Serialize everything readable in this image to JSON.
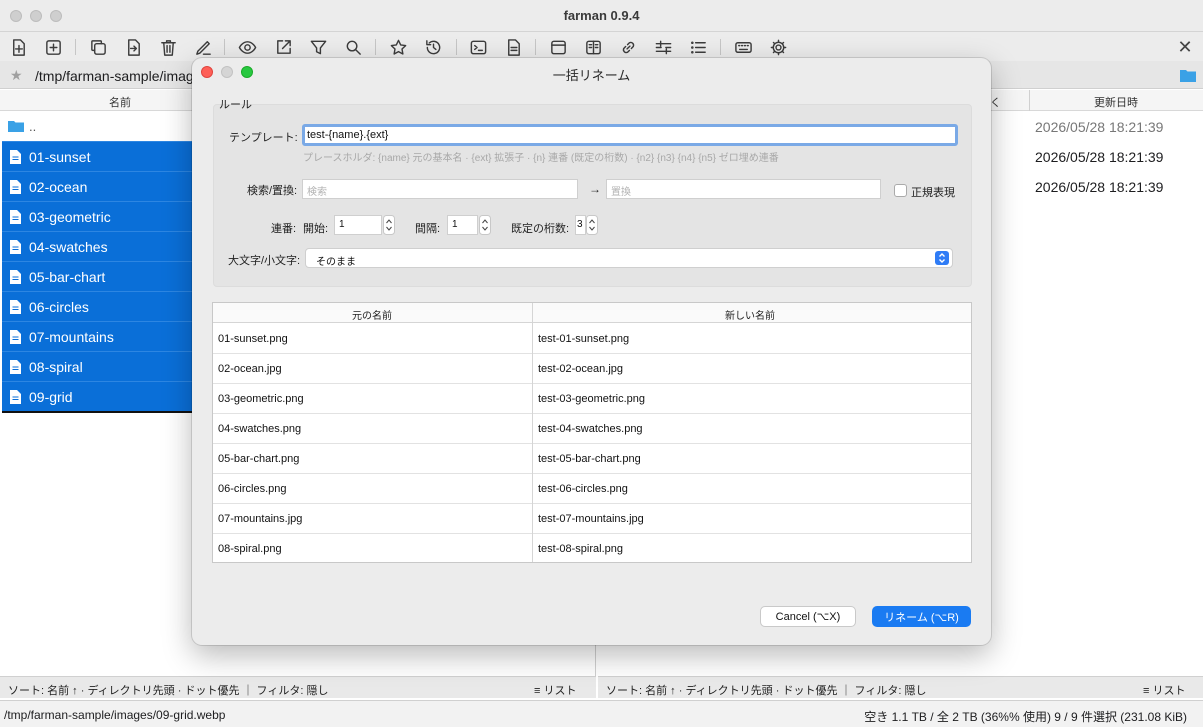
{
  "window": {
    "title": "farman 0.9.4"
  },
  "toolbar": {
    "icons": [
      "new-file-icon",
      "new-folder-icon",
      "copy-icon",
      "move-icon",
      "trash-icon",
      "rename-icon",
      "view-icon",
      "open-external-icon",
      "filter-icon",
      "search-icon",
      "bookmark-icon",
      "history-icon",
      "terminal-icon",
      "document-icon",
      "layout-icon",
      "book-icon",
      "link-icon",
      "compare-icon",
      "list-icon",
      "keyboard-icon",
      "gear-icon"
    ],
    "close_glyph": "✕"
  },
  "left_pane": {
    "path": "/tmp/farman-sample/images",
    "column_name": "名前",
    "parent": "..",
    "items": [
      "01-sunset",
      "02-ocean",
      "03-geometric",
      "04-swatches",
      "05-bar-chart",
      "06-circles",
      "07-mountains",
      "08-spiral",
      "09-grid"
    ],
    "footer": "ソート: 名前 ↑ · ディレクトリ先頭 · ドット優先 ｜ フィルタ: 隠し",
    "view_label": "≡ リスト"
  },
  "right_pane": {
    "column_date": "更新日時",
    "dates": [
      "2026/05/28 18:21:39",
      "2026/05/28 18:21:39",
      "2026/05/28 18:21:39"
    ],
    "footer": "ソート: 名前 ↑ · ディレクトリ先頭 · ドット優先 ｜ フィルタ: 隠し",
    "view_label": "≡ リスト"
  },
  "status_bar": {
    "path": "/tmp/farman-sample/images/09-grid.webp",
    "info": "空き 1.1 TB / 全 2 TB (36%% 使用)  9 / 9 件選択 (231.08 KiB)"
  },
  "dialog": {
    "title": "一括リネーム",
    "rule_label": "ルール",
    "template_label": "テンプレート:",
    "template_value": "test-{name}.{ext}",
    "placeholder_hint": "プレースホルダ: {name} 元の基本名 · {ext} 拡張子 · {n} 連番 (既定の桁数) · {n2} {n3} {n4} {n5} ゼロ埋め連番",
    "search_replace_label": "検索/置換:",
    "search_placeholder": "検索",
    "arrow": "→",
    "replace_placeholder": "置換",
    "regex_label": "正規表現",
    "sequence_label": "連番:",
    "start_label": "開始:",
    "start_value": "1",
    "step_label": "間隔:",
    "step_value": "1",
    "digits_label": "既定の桁数:",
    "digits_value": "3",
    "case_label": "大文字/小文字:",
    "case_value": "そのまま",
    "table": {
      "col_original": "元の名前",
      "col_new": "新しい名前",
      "rows": [
        [
          "01-sunset.png",
          "test-01-sunset.png"
        ],
        [
          "02-ocean.jpg",
          "test-02-ocean.jpg"
        ],
        [
          "03-geometric.png",
          "test-03-geometric.png"
        ],
        [
          "04-swatches.png",
          "test-04-swatches.png"
        ],
        [
          "05-bar-chart.png",
          "test-05-bar-chart.png"
        ],
        [
          "06-circles.png",
          "test-06-circles.png"
        ],
        [
          "07-mountains.jpg",
          "test-07-mountains.jpg"
        ],
        [
          "08-spiral.png",
          "test-08-spiral.png"
        ]
      ]
    },
    "cancel_label": "Cancel (⌥X)",
    "ok_label": "リネーム (⌥R)",
    "accent_color": "#1a7bf2"
  }
}
